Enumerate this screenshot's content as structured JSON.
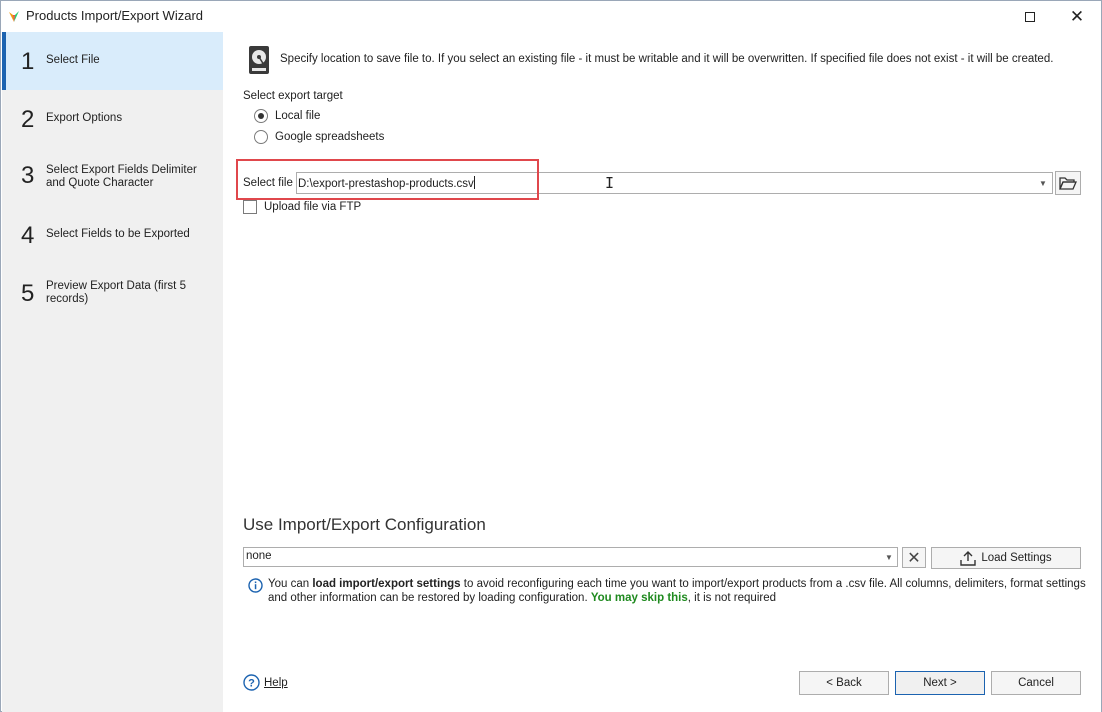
{
  "window": {
    "title": "Products Import/Export Wizard"
  },
  "sidebar": {
    "steps": [
      {
        "num": "1",
        "label": "Select File",
        "active": true
      },
      {
        "num": "2",
        "label": "Export Options"
      },
      {
        "num": "3",
        "label": "Select Export Fields Delimiter and Quote Character"
      },
      {
        "num": "4",
        "label": "Select Fields to be Exported"
      },
      {
        "num": "5",
        "label": "Preview Export Data (first 5 records)"
      }
    ]
  },
  "main": {
    "info": "Specify location to save file to. If you select an existing file - it must be writable and it will be overwritten. If specified file does not exist - it will be created.",
    "export_target_label": "Select export target",
    "targets": [
      {
        "label": "Local file",
        "selected": true
      },
      {
        "label": "Google spreadsheets",
        "selected": false
      }
    ],
    "select_file_label": "Select file",
    "file_value": "D:\\export-prestashop-products.csv",
    "upload_ftp_label": "Upload file via FTP",
    "config_title": "Use Import/Export Configuration",
    "config_value": "none",
    "load_settings_label": "Load Settings",
    "note": {
      "part1": "You can ",
      "bold1": "load import/export settings",
      "part2": " to avoid reconfiguring each time you want to import/export products from a .csv file. All columns, delimiters, format settings and other information can be restored by loading configuration. ",
      "green": "You may skip this",
      "part3": ", it is not required"
    }
  },
  "footer": {
    "help_label": "Help",
    "back_label": "< Back",
    "next_label": "Next >",
    "cancel_label": "Cancel"
  },
  "colors": {
    "accent": "#1c63b0",
    "active_step_bg": "#d9ecfb",
    "highlight": "#e0474c",
    "skip_green": "#1f8a1f"
  }
}
